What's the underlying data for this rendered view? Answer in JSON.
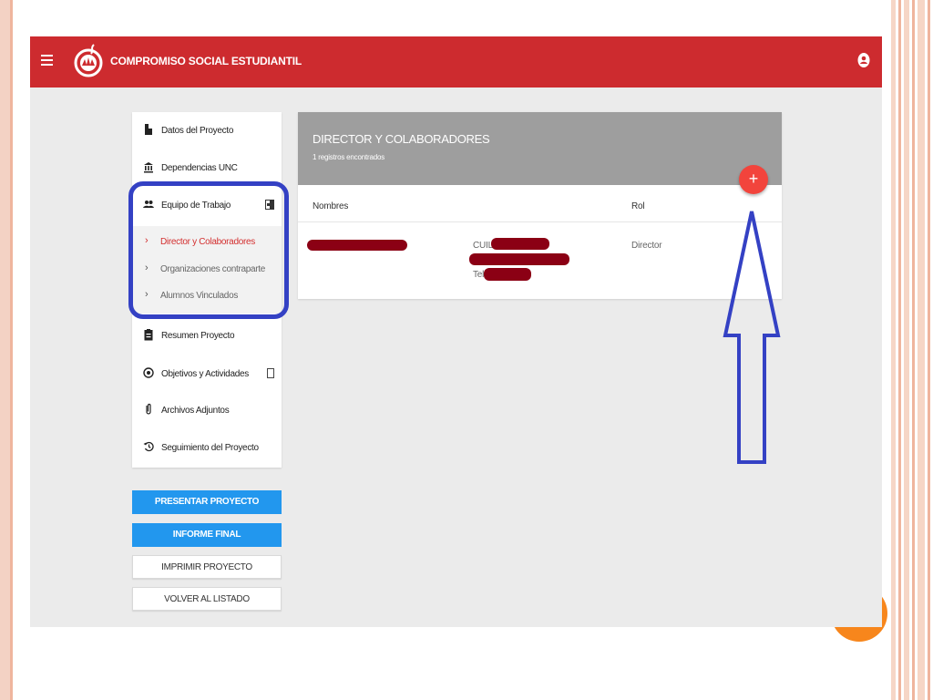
{
  "app": {
    "title": "COMPROMISO SOCIAL ESTUDIANTIL",
    "brand_color": "#cd2b2f"
  },
  "sidebar": {
    "items": [
      {
        "label": "Datos del Proyecto",
        "icon": "document-icon"
      },
      {
        "label": "Dependencias UNC",
        "icon": "institution-icon"
      },
      {
        "label": "Equipo de Trabajo",
        "icon": "people-icon"
      },
      {
        "label": "Resumen Proyecto",
        "icon": "clipboard-icon"
      },
      {
        "label": "Objetivos y Actividades",
        "icon": "target-icon"
      },
      {
        "label": "Archivos Adjuntos",
        "icon": "paperclip-icon"
      },
      {
        "label": "Seguimiento del Proyecto",
        "icon": "history-icon"
      }
    ],
    "subitems": [
      {
        "label": "Director y Colaboradores",
        "active": true
      },
      {
        "label": "Organizaciones contraparte",
        "active": false
      },
      {
        "label": "Alumnos Vinculados",
        "active": false
      }
    ]
  },
  "buttons": {
    "presentar": "PRESENTAR PROYECTO",
    "informe": "INFORME FINAL",
    "imprimir": "IMPRIMIR PROYECTO",
    "volver": "VOLVER AL LISTADO"
  },
  "card": {
    "title": "DIRECTOR Y COLABORADORES",
    "subtitle": "1 registros encontrados",
    "fab": "+",
    "columns": {
      "nombres": "Nombres",
      "rol": "Rol"
    },
    "row": {
      "cuil_label": "CUIL:",
      "tel_label": "Tel:",
      "rol": "Director"
    }
  },
  "colors": {
    "accent_blue": "#2297ee",
    "active_red": "#d32f2f",
    "annotation_blue": "#3441c4",
    "header_gray": "#9e9e9e"
  }
}
